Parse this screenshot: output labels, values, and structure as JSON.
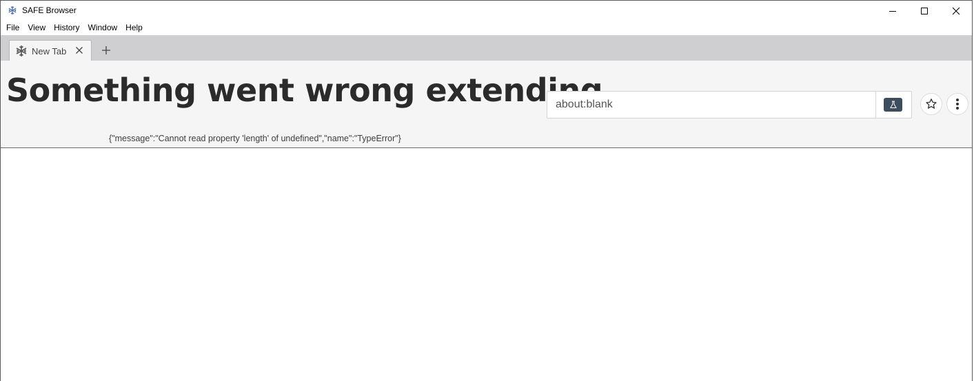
{
  "window": {
    "title": "SAFE Browser",
    "app_icon": "safe-logo-icon",
    "controls": {
      "minimize_icon": "minimize-icon",
      "maximize_icon": "maximize-icon",
      "close_icon": "close-icon"
    }
  },
  "menubar": {
    "items": [
      {
        "label": "File"
      },
      {
        "label": "View"
      },
      {
        "label": "History"
      },
      {
        "label": "Window"
      },
      {
        "label": "Help"
      }
    ]
  },
  "tabs": [
    {
      "label": "New Tab",
      "icon": "safe-logo-icon",
      "close_icon": "x-icon",
      "active": true
    }
  ],
  "new_tab_icon": "plus-icon",
  "error": {
    "title": "Something went wrong extending",
    "message": "{\"message\":\"Cannot read property 'length' of undefined\",\"name\":\"TypeError\"}"
  },
  "address_bar": {
    "value": "about:blank",
    "experiments_icon": "flask-icon"
  },
  "toolbar_buttons": {
    "bookmark_icon": "star-icon",
    "menu_icon": "vertical-dots-icon"
  },
  "colors": {
    "tabstrip": "#cfcfd1",
    "toolbar": "#f5f5f5",
    "experiments_button": "#3e4d5e",
    "title_text": "#2b2b2b"
  }
}
